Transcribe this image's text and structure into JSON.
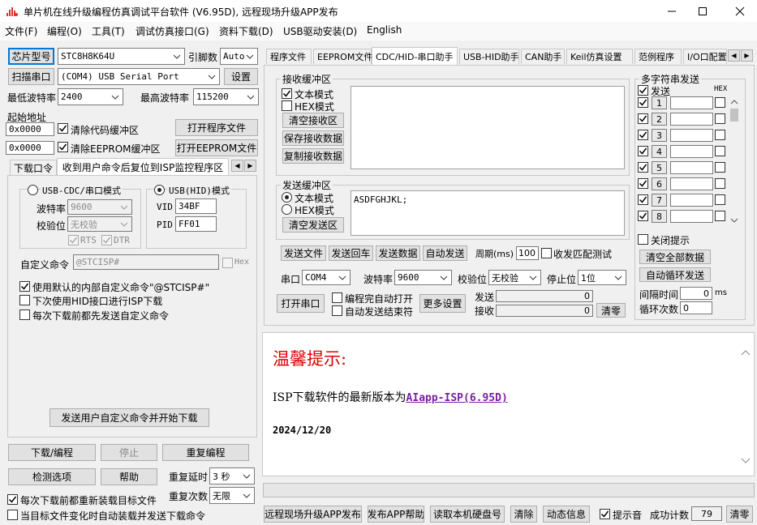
{
  "window": {
    "title": "单片机在线升级编程仿真调试平台软件 (V6.95D), 远程现场升级APP发布"
  },
  "menu": [
    "文件(F)",
    "编程(O)",
    "工具(T)",
    "调试仿真接口(G)",
    "资料下载(D)",
    "USB驱动安装(D)",
    "English"
  ],
  "left": {
    "chip_btn": "芯片型号",
    "chip_value": "STC8H8K64U",
    "pin_label": "引脚数",
    "pin_value": "Auto",
    "scan_btn": "扫描串口",
    "port_value": "(COM4) USB Serial Port",
    "settings_btn": "设置",
    "min_baud_label": "最低波特率",
    "min_baud_value": "2400",
    "max_baud_label": "最高波特率",
    "max_baud_value": "115200",
    "start_addr_label": "起始地址",
    "addr1": "0x0000",
    "addr2": "0x0000",
    "clear_code_label": "清除代码缓冲区",
    "clear_eeprom_label": "清除EEPROM缓冲区",
    "open_prog_btn": "打开程序文件",
    "open_eeprom_btn": "打开EEPROM文件",
    "tab1": "下载口令",
    "tab2": "收到用户命令后复位到ISP监控程序区",
    "usb_cdc_label": "USB-CDC/串口模式",
    "usb_hid_label": "USB(HID)模式",
    "baud_label": "波特率",
    "baud_value": "9600",
    "parity_label": "校验位",
    "parity_value": "无校验",
    "rts_label": "RTS",
    "dtr_label": "DTR",
    "vid_label": "VID",
    "vid_value": "34BF",
    "pid_label": "PID",
    "pid_value": "FF01",
    "custom_cmd_label": "自定义命令",
    "custom_cmd_value": "@STCISP#",
    "hex_label": "Hex",
    "opt1": "使用默认的内部自定义命令\"@STCISP#\"",
    "opt2": "下次使用HID接口进行ISP下载",
    "opt3": "每次下载前都先发送自定义命令",
    "send_cmd_btn": "发送用户自定义命令并开始下载",
    "download_btn": "下载/编程",
    "stop_btn": "停止",
    "reprogram_btn": "重复编程",
    "check_btn": "检测选项",
    "help_btn": "帮助",
    "repeat_delay_label": "重复延时",
    "repeat_delay_value": "3 秒",
    "repeat_count_label": "重复次数",
    "repeat_count_value": "无限",
    "reload_label": "每次下载前都重新装载目标文件",
    "auto_load_label": "当目标文件变化时自动装载并发送下载命令"
  },
  "right": {
    "tabs": [
      "程序文件",
      "EEPROM文件",
      "CDC/HID-串口助手",
      "USB-HID助手",
      "CAN助手",
      "Keil仿真设置",
      "范例程序",
      "I/O口配置"
    ],
    "recv": {
      "title": "接收缓冲区",
      "text_mode": "文本模式",
      "hex_mode": "HEX模式",
      "clear_btn": "清空接收区",
      "save_btn": "保存接收数据",
      "copy_btn": "复制接收数据"
    },
    "send": {
      "title": "发送缓冲区",
      "text_mode": "文本模式",
      "hex_mode": "HEX模式",
      "clear_btn": "清空发送区",
      "content": "ASDFGHJKL;",
      "send_file_btn": "发送文件",
      "send_cr_btn": "发送回车",
      "send_data_btn": "发送数据",
      "auto_send_btn": "自动发送",
      "period_label": "周期(ms)",
      "period_value": "100",
      "match_label": "收发匹配测试"
    },
    "serial": {
      "port_label": "串口",
      "port_value": "COM4",
      "baud_label": "波特率",
      "baud_value": "9600",
      "parity_label": "校验位",
      "parity_value": "无校验",
      "stop_label": "停止位",
      "stop_value": "1位",
      "open_btn": "打开串口",
      "auto_open_label": "编程完自动打开",
      "auto_send_end_label": "自动发送结束符",
      "more_btn": "更多设置",
      "send_label": "发送",
      "send_count": "0",
      "recv_label": "接收",
      "recv_count": "0",
      "clear_btn": "清零"
    },
    "multi": {
      "title": "多字符串发送",
      "send_header": "发送",
      "hex_header": "HEX",
      "rows": [
        "1",
        "2",
        "3",
        "4",
        "5",
        "6",
        "7",
        "8"
      ],
      "close_hint_label": "关闭提示",
      "clear_all_btn": "清空全部数据",
      "auto_loop_btn": "自动循环发送",
      "interval_label": "间隔时间",
      "interval_value": "0",
      "interval_unit": "ms",
      "loop_label": "循环次数",
      "loop_value": "0"
    },
    "notice": {
      "title": "温馨提示:",
      "line_prefix": "ISP下载软件的最新版本为",
      "link": "AIapp-ISP(6.95D)",
      "date": "2024/12/20"
    }
  },
  "bottom": {
    "publish_btn": "远程现场升级APP发布",
    "app_help_btn": "发布APP帮助",
    "read_disk_btn": "读取本机硬盘号",
    "clear_btn": "清除",
    "dynamic_btn": "动态信息",
    "beep_label": "提示音",
    "success_label": "成功计数",
    "success_value": "79",
    "zero_btn": "清零"
  },
  "colors": {
    "notice_title": "#e00000",
    "link": "#7a1fa2",
    "icon": "#e0312b"
  }
}
